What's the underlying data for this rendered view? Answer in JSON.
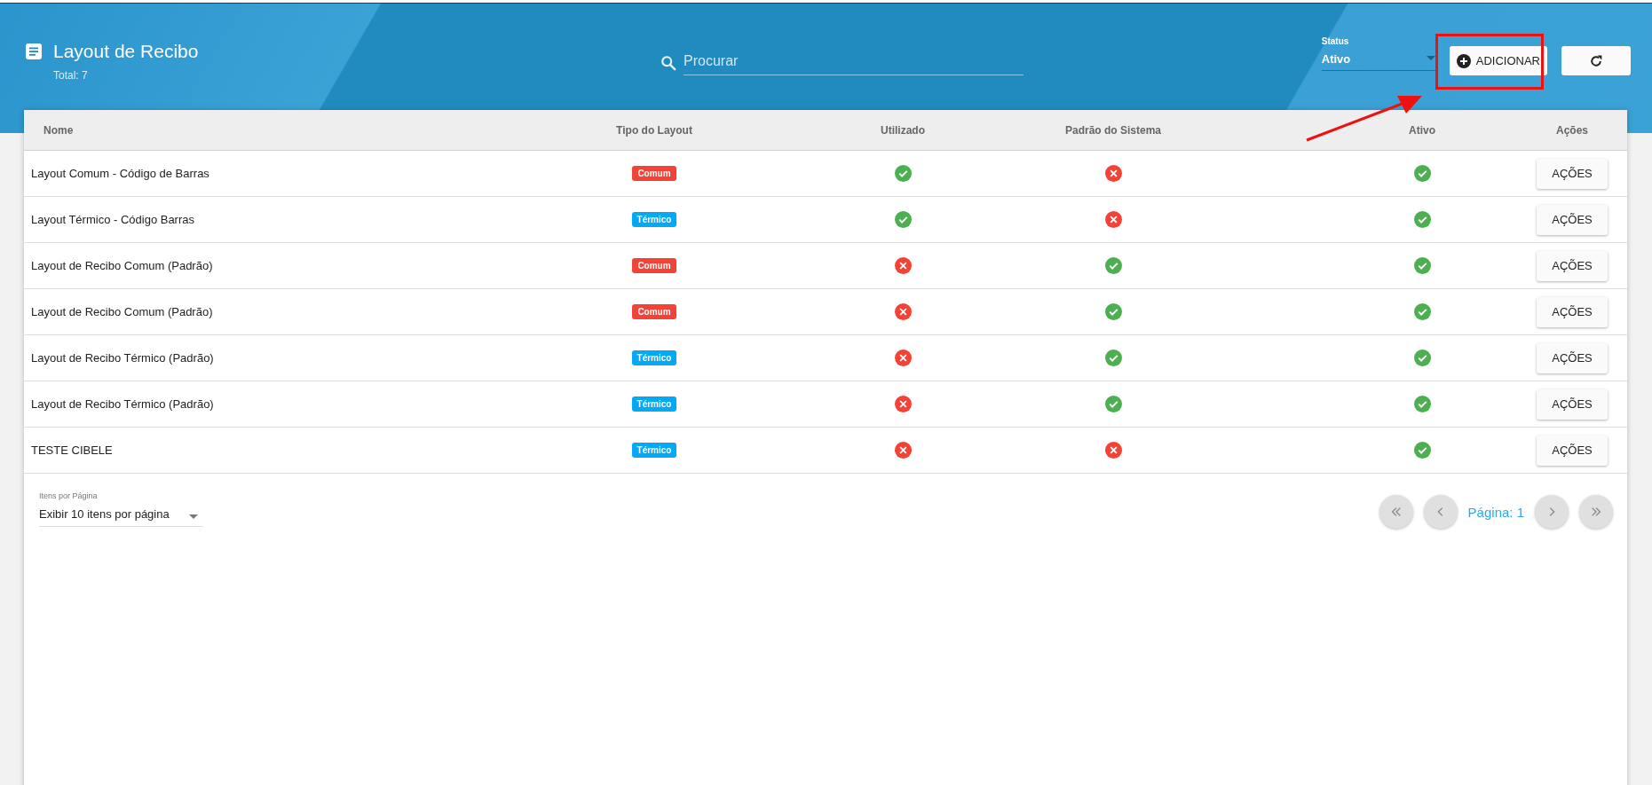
{
  "header": {
    "title": "Layout de Recibo",
    "total": "Total: 7",
    "search": {
      "placeholder": "Procurar"
    },
    "status": {
      "label": "Status",
      "value": "Ativo"
    },
    "add_button": "ADICIONAR"
  },
  "table": {
    "columns": [
      "Nome",
      "Tipo do Layout",
      "Utilizado",
      "Padrão do Sistema",
      "Ativo",
      "Ações"
    ],
    "rows": [
      {
        "name": "Layout Comum - Código de Barras",
        "type": {
          "label": "Comum",
          "kind": "comum"
        },
        "used": true,
        "system_default": false,
        "active": true,
        "action": "AÇÕES"
      },
      {
        "name": "Layout Térmico - Código Barras",
        "type": {
          "label": "Térmico",
          "kind": "termico"
        },
        "used": true,
        "system_default": false,
        "active": true,
        "action": "AÇÕES"
      },
      {
        "name": "Layout de Recibo Comum (Padrão)",
        "type": {
          "label": "Comum",
          "kind": "comum"
        },
        "used": false,
        "system_default": true,
        "active": true,
        "action": "AÇÕES"
      },
      {
        "name": "Layout de Recibo Comum (Padrão)",
        "type": {
          "label": "Comum",
          "kind": "comum"
        },
        "used": false,
        "system_default": true,
        "active": true,
        "action": "AÇÕES"
      },
      {
        "name": "Layout de Recibo Térmico (Padrão)",
        "type": {
          "label": "Térmico",
          "kind": "termico"
        },
        "used": false,
        "system_default": true,
        "active": true,
        "action": "AÇÕES"
      },
      {
        "name": "Layout de Recibo Térmico (Padrão)",
        "type": {
          "label": "Térmico",
          "kind": "termico"
        },
        "used": false,
        "system_default": true,
        "active": true,
        "action": "AÇÕES"
      },
      {
        "name": "TESTE CIBELE",
        "type": {
          "label": "Térmico",
          "kind": "termico"
        },
        "used": false,
        "system_default": false,
        "active": true,
        "action": "AÇÕES"
      }
    ]
  },
  "footer": {
    "per_page": {
      "label": "Itens por Página",
      "value": "Exibir 10 itens por página"
    },
    "page": "Página: 1"
  }
}
